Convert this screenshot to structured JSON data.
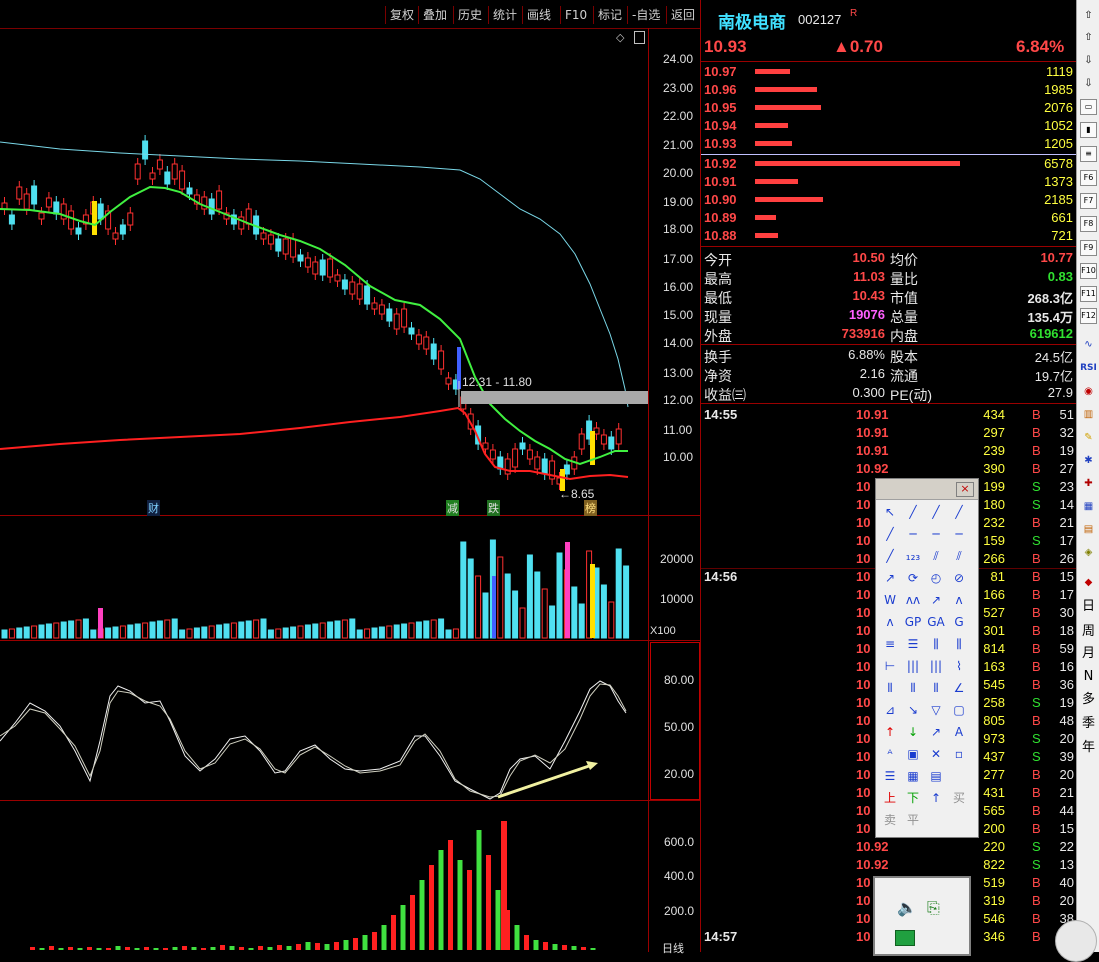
{
  "toolbar": {
    "buttons": [
      "复权",
      "叠加",
      "历史",
      "统计",
      "画线",
      "F10",
      "标记",
      "-自选",
      "返回"
    ]
  },
  "price_axis": [
    "24.00",
    "23.00",
    "22.00",
    "21.00",
    "20.00",
    "19.00",
    "18.00",
    "17.00",
    "16.00",
    "15.00",
    "14.00",
    "13.00",
    "12.00",
    "11.00",
    "10.00"
  ],
  "main_chart": {
    "range_label": "12.31 - 11.80",
    "low_label": "8.65",
    "markers": [
      "财",
      "减",
      "跌",
      "榜"
    ]
  },
  "volume_axis": [
    "20000",
    "10000"
  ],
  "volume_unit": "X100",
  "kdj_axis": [
    "80.00",
    "50.00",
    "20.00"
  ],
  "flow_axis": [
    "600.0",
    "400.0",
    "200.0"
  ],
  "flow_bottom_label": "日线",
  "stock": {
    "name": "南极电商",
    "code": "002127",
    "flag": "R",
    "price": "10.93",
    "change": "▲0.70",
    "change_pct": "6.84%"
  },
  "asks": [
    {
      "price": "10.97",
      "vol": "1119",
      "bar": 0.17
    },
    {
      "price": "10.96",
      "vol": "1985",
      "bar": 0.3
    },
    {
      "price": "10.95",
      "vol": "2076",
      "bar": 0.32
    },
    {
      "price": "10.94",
      "vol": "1052",
      "bar": 0.16
    },
    {
      "price": "10.93",
      "vol": "1205",
      "bar": 0.18
    }
  ],
  "bids": [
    {
      "price": "10.92",
      "vol": "6578",
      "bar": 1.0
    },
    {
      "price": "10.91",
      "vol": "1373",
      "bar": 0.21
    },
    {
      "price": "10.90",
      "vol": "2185",
      "bar": 0.33
    },
    {
      "price": "10.89",
      "vol": "661",
      "bar": 0.1
    },
    {
      "price": "10.88",
      "vol": "721",
      "bar": 0.11
    }
  ],
  "stats_left": [
    {
      "label": "今开",
      "value": "10.50",
      "cls": "red"
    },
    {
      "label": "最高",
      "value": "11.03",
      "cls": "red"
    },
    {
      "label": "最低",
      "value": "10.43",
      "cls": "red"
    },
    {
      "label": "现量",
      "value": "19076",
      "cls": "purple"
    },
    {
      "label": "外盘",
      "value": "733916",
      "cls": "red"
    }
  ],
  "stats_right": [
    {
      "label": "均价",
      "value": "10.77",
      "cls": "red"
    },
    {
      "label": "量比",
      "value": "0.83",
      "cls": "green"
    },
    {
      "label": "市值",
      "value": "268.3亿",
      "cls": "white"
    },
    {
      "label": "总量",
      "value": "135.4万",
      "cls": "white"
    },
    {
      "label": "内盘",
      "value": "619612",
      "cls": "green"
    }
  ],
  "stats2_left": [
    {
      "label": "换手",
      "value": "6.88%"
    },
    {
      "label": "净资",
      "value": "2.16"
    },
    {
      "label": "收益㈢",
      "value": "0.300"
    }
  ],
  "stats2_right": [
    {
      "label": "股本",
      "value": "24.5亿"
    },
    {
      "label": "流通",
      "value": "19.7亿"
    },
    {
      "label": "PE(动)",
      "value": "27.9"
    }
  ],
  "trades": [
    {
      "time": "14:55",
      "price": "10.91",
      "vol": "434",
      "bs": "B",
      "n": "51"
    },
    {
      "time": "",
      "price": "10.91",
      "vol": "297",
      "bs": "B",
      "n": "32"
    },
    {
      "time": "",
      "price": "10.91",
      "vol": "239",
      "bs": "B",
      "n": "19"
    },
    {
      "time": "",
      "price": "10.92",
      "vol": "390",
      "bs": "B",
      "n": "27"
    },
    {
      "time": "",
      "price": "10",
      "vol": "199",
      "bs": "S",
      "n": "23"
    },
    {
      "time": "",
      "price": "10",
      "vol": "180",
      "bs": "S",
      "n": "14"
    },
    {
      "time": "",
      "price": "10",
      "vol": "232",
      "bs": "B",
      "n": "21"
    },
    {
      "time": "",
      "price": "10",
      "vol": "159",
      "bs": "S",
      "n": "17"
    },
    {
      "time": "",
      "price": "10",
      "vol": "266",
      "bs": "B",
      "n": "26"
    },
    {
      "time": "14:56",
      "price": "10",
      "vol": "81",
      "bs": "B",
      "n": "15"
    },
    {
      "time": "",
      "price": "10",
      "vol": "166",
      "bs": "B",
      "n": "17"
    },
    {
      "time": "",
      "price": "10",
      "vol": "527",
      "bs": "B",
      "n": "30"
    },
    {
      "time": "",
      "price": "10",
      "vol": "301",
      "bs": "B",
      "n": "18"
    },
    {
      "time": "",
      "price": "10",
      "vol": "814",
      "bs": "B",
      "n": "59"
    },
    {
      "time": "",
      "price": "10",
      "vol": "163",
      "bs": "B",
      "n": "16"
    },
    {
      "time": "",
      "price": "10",
      "vol": "545",
      "bs": "B",
      "n": "36"
    },
    {
      "time": "",
      "price": "10",
      "vol": "258",
      "bs": "S",
      "n": "19"
    },
    {
      "time": "",
      "price": "10",
      "vol": "805",
      "bs": "B",
      "n": "48"
    },
    {
      "time": "",
      "price": "10",
      "vol": "973",
      "bs": "S",
      "n": "20"
    },
    {
      "time": "",
      "price": "10",
      "vol": "437",
      "bs": "S",
      "n": "39"
    },
    {
      "time": "",
      "price": "10",
      "vol": "277",
      "bs": "B",
      "n": "20"
    },
    {
      "time": "",
      "price": "10",
      "vol": "431",
      "bs": "B",
      "n": "21"
    },
    {
      "time": "",
      "price": "10",
      "vol": "565",
      "bs": "B",
      "n": "44"
    },
    {
      "time": "",
      "price": "10",
      "vol": "200",
      "bs": "B",
      "n": "15"
    },
    {
      "time": "",
      "price": "10.92",
      "vol": "220",
      "bs": "S",
      "n": "22"
    },
    {
      "time": "",
      "price": "10.92",
      "vol": "822",
      "bs": "S",
      "n": "13"
    },
    {
      "time": "",
      "price": "10",
      "vol": "519",
      "bs": "B",
      "n": "40"
    },
    {
      "time": "",
      "price": "10",
      "vol": "319",
      "bs": "B",
      "n": "20"
    },
    {
      "time": "",
      "price": "10",
      "vol": "546",
      "bs": "B",
      "n": "38"
    },
    {
      "time": "14:57",
      "price": "10",
      "vol": "346",
      "bs": "B",
      "n": "21"
    }
  ],
  "strip": {
    "rsi": "RSI",
    "periods": [
      "日",
      "周",
      "月",
      "N",
      "多",
      "季",
      "年"
    ],
    "fkeys": [
      "F6",
      "F7",
      "F8",
      "F9",
      "F10",
      "F11",
      "F12"
    ]
  },
  "palette": {
    "close": "×",
    "trade_labels": [
      "上",
      "下",
      "↑",
      "买",
      "卖",
      "平"
    ],
    "tool_labels": [
      "123",
      "GP",
      "GA",
      "G"
    ]
  }
}
